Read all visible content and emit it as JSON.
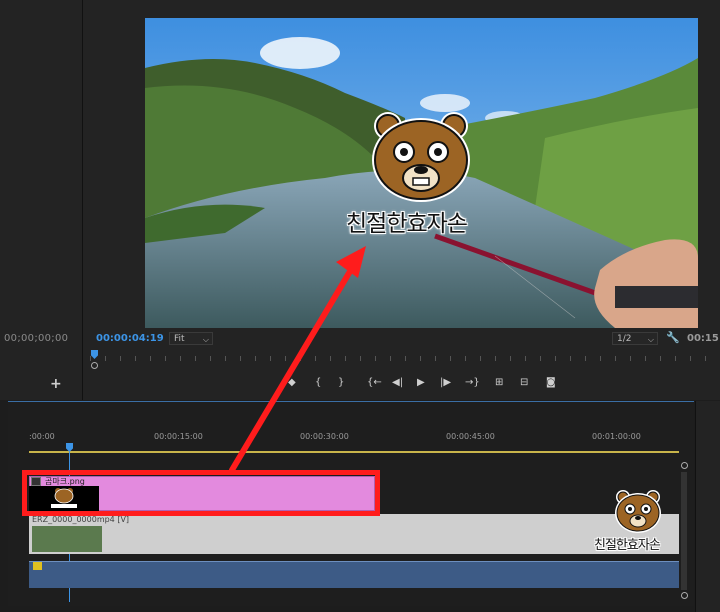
{
  "source_monitor": {
    "timecode": "00;00;00;00",
    "add_button": "+"
  },
  "program_monitor": {
    "timecode": "00:00:04:19",
    "zoom_select": "Fit",
    "resolution_select": "1/2",
    "duration_partial": "00:15"
  },
  "transport": {
    "mark_in": "{",
    "mark_out": "}",
    "go_to_in": "{←",
    "step_back": "◀|",
    "play": "▶",
    "step_forward": "|▶",
    "go_to_out": "→}"
  },
  "timeline": {
    "ruler_start": ":00:00",
    "ruler_labels": [
      "00:00:15:00",
      "00:00:30:00",
      "00:00:45:00",
      "00:01:00:00"
    ],
    "v2_clip_name": "곰마크.png",
    "v1_clip_name": "ERZ_0000_0000mp4 [V]"
  },
  "overlay": {
    "caption": "친절한효자손"
  },
  "watermark": {
    "caption": "친절한효자손"
  },
  "colors": {
    "accent_blue": "#3c94e6",
    "clip_pink": "#e38ade",
    "annotation_red": "#ff1c1c",
    "audio_blue": "#3d5b86"
  }
}
